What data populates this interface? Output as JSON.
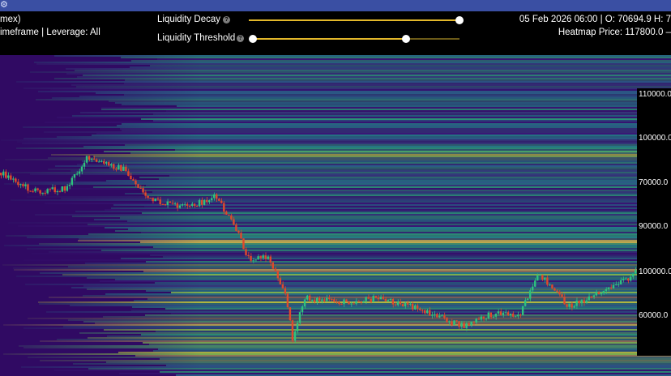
{
  "header": {
    "exchange_fragment": "mex)",
    "filters_text": "imeframe | Leverage: All",
    "ohlc_text": "05 Feb 2026 06:00 | O: 70694.9 H: 7",
    "heatmap_price_text": "Heatmap Price: 117800.0 –"
  },
  "controls": {
    "decay_label": "Liquidity Decay",
    "decay_value": 1.0,
    "threshold_label": "Liquidity Threshold",
    "threshold_min": 0.0,
    "threshold_max": 0.74,
    "help_glyph": "?"
  },
  "y_axis": {
    "labels": [
      "110000.0",
      "100000.0",
      "70000.0",
      "90000.0",
      "100000.0",
      "60000.0"
    ]
  },
  "colors": {
    "background": "#300a63",
    "accent": "#e2b72a",
    "candle_up": "#2ec27e",
    "candle_down": "#e0492b"
  }
}
